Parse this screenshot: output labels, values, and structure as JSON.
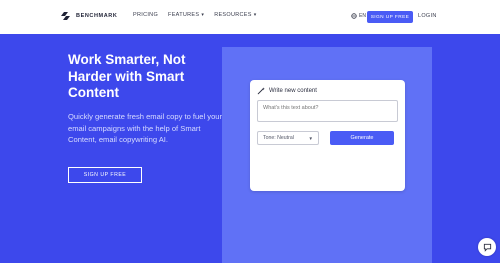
{
  "nav": {
    "logo_text": "BENCHMARK",
    "links": [
      {
        "label": "PRICING"
      },
      {
        "label": "FEATURES"
      },
      {
        "label": "RESOURCES"
      }
    ],
    "language": "EN",
    "signup_label": "SIGN UP FREE",
    "login_label": "LOGIN"
  },
  "hero": {
    "title": "Work Smarter, Not Harder with Smart Content",
    "description": "Quickly generate fresh email copy to fuel your email campaigns with the help of Smart Content, email copywriting AI.",
    "cta_label": "SIGN UP FREE"
  },
  "card": {
    "title": "Write new content",
    "input_placeholder": "What's this text about?",
    "tone_label": "Tone: Neutral",
    "generate_label": "Generate"
  },
  "colors": {
    "brand_blue": "#3d48ec",
    "panel_blue": "#6071f6",
    "button_blue": "#4a5bf5"
  }
}
